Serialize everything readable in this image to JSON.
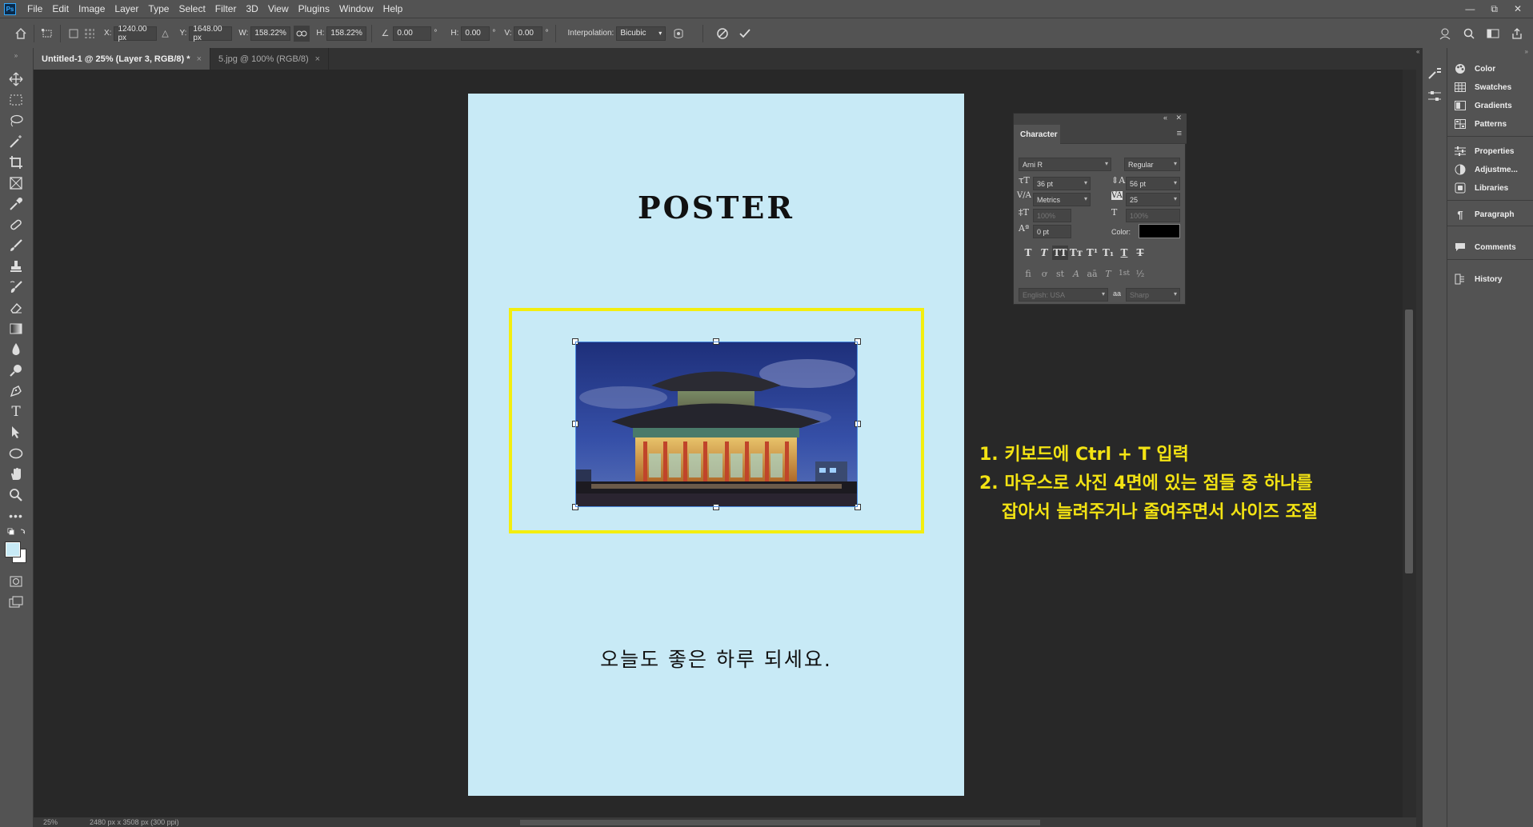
{
  "app": {
    "logo": "Ps"
  },
  "menu": [
    "File",
    "Edit",
    "Image",
    "Layer",
    "Type",
    "Select",
    "Filter",
    "3D",
    "View",
    "Plugins",
    "Window",
    "Help"
  ],
  "window_controls": {
    "minimize": "—",
    "restore": "⧉",
    "close": "✕"
  },
  "options": {
    "x_label": "X:",
    "x_value": "1240.00 px",
    "y_label": "Y:",
    "y_value": "1648.00 px",
    "w_label": "W:",
    "w_value": "158.22%",
    "h_label": "H:",
    "h_value": "158.22%",
    "angle_value": "0.00",
    "deg": "°",
    "hskew_label": "H:",
    "hskew_value": "0.00",
    "vskew_label": "V:",
    "vskew_value": "0.00",
    "interp_label": "Interpolation:",
    "interp_value": "Bicubic",
    "cancel_icon": "cancel-icon",
    "commit_icon": "commit-check-icon"
  },
  "tabs": [
    {
      "label": "Untitled-1 @ 25% (Layer 3, RGB/8) *",
      "active": true,
      "close": "×"
    },
    {
      "label": "5.jpg @ 100% (RGB/8)",
      "active": false,
      "close": "×"
    }
  ],
  "poster": {
    "title": "POSTER",
    "subtitle": "오늘도 좋은 하루 되세요.",
    "background": "#c8eaf6",
    "highlight_color": "#f3ee0f"
  },
  "annotation": {
    "line1": "1. 키보드에 Ctrl + T 입력",
    "line2": "2. 마우스로 사진 4면에 있는 점들 중 하나를",
    "line3": "잡아서 늘려주거나 줄여주면서 사이즈 조절",
    "color": "#f3e313"
  },
  "status": {
    "zoom": "25%",
    "doc_info": "2480 px x 3508 px (300 ppi)"
  },
  "character_panel": {
    "tab": "Character",
    "font_family": "Arni R",
    "font_style": "Regular",
    "font_size": "36 pt",
    "leading": "56 pt",
    "kerning": "Metrics",
    "tracking": "25",
    "vscale": "100%",
    "hscale": "100%",
    "baseline": "0 pt",
    "color_label": "Color:",
    "color_value": "#000000",
    "language": "English: USA",
    "aa_label": "aa",
    "antialias": "Sharp",
    "style_buttons": [
      "T",
      "T",
      "TT",
      "Tт",
      "T¹",
      "T₁",
      "T",
      "T"
    ],
    "feature_buttons": [
      "fi",
      "ơ",
      "st",
      "A",
      "aā",
      "T",
      "1st",
      "½"
    ]
  },
  "dock": {
    "items": [
      {
        "label": "Color",
        "icon": "color-icon"
      },
      {
        "label": "Swatches",
        "icon": "swatches-icon"
      },
      {
        "label": "Gradients",
        "icon": "gradients-icon"
      },
      {
        "label": "Patterns",
        "icon": "patterns-icon"
      },
      {
        "label": "Properties",
        "icon": "properties-icon"
      },
      {
        "label": "Adjustme...",
        "icon": "adjustments-icon"
      },
      {
        "label": "Libraries",
        "icon": "libraries-icon"
      },
      {
        "label": "Paragraph",
        "icon": "paragraph-icon"
      },
      {
        "label": "Comments",
        "icon": "comments-icon"
      },
      {
        "label": "History",
        "icon": "history-icon"
      }
    ]
  }
}
